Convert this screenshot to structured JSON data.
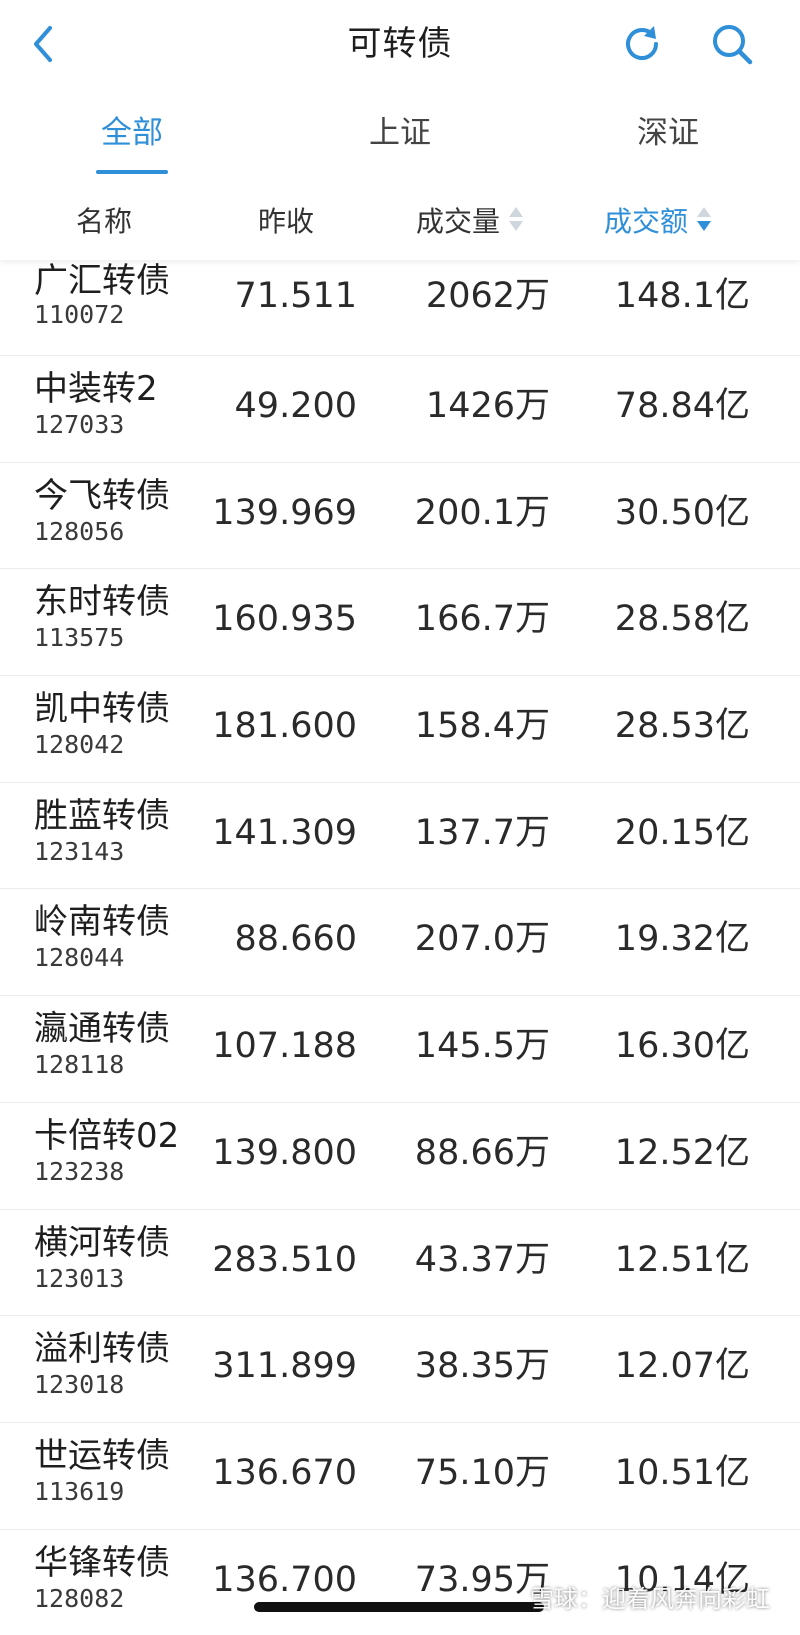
{
  "header": {
    "title": "可转债"
  },
  "icons": {
    "back": "chevron-left-icon",
    "refresh": "refresh-icon",
    "search": "search-icon"
  },
  "colors": {
    "accent": "#2f8fd8"
  },
  "tabs": [
    {
      "label": "全部",
      "active": true
    },
    {
      "label": "上证",
      "active": false
    },
    {
      "label": "深证",
      "active": false
    }
  ],
  "columns": {
    "name": "名称",
    "close": "昨收",
    "volume": "成交量",
    "amount": "成交额",
    "sorted_by": "amount",
    "sort_order": "desc"
  },
  "rows": [
    {
      "name": "广汇转债",
      "code": "110072",
      "close": "71.511",
      "volume": "2062万",
      "amount": "148.1亿"
    },
    {
      "name": "中装转2",
      "code": "127033",
      "close": "49.200",
      "volume": "1426万",
      "amount": "78.84亿"
    },
    {
      "name": "今飞转债",
      "code": "128056",
      "close": "139.969",
      "volume": "200.1万",
      "amount": "30.50亿"
    },
    {
      "name": "东时转债",
      "code": "113575",
      "close": "160.935",
      "volume": "166.7万",
      "amount": "28.58亿"
    },
    {
      "name": "凯中转债",
      "code": "128042",
      "close": "181.600",
      "volume": "158.4万",
      "amount": "28.53亿"
    },
    {
      "name": "胜蓝转债",
      "code": "123143",
      "close": "141.309",
      "volume": "137.7万",
      "amount": "20.15亿"
    },
    {
      "name": "岭南转债",
      "code": "128044",
      "close": "88.660",
      "volume": "207.0万",
      "amount": "19.32亿"
    },
    {
      "name": "瀛通转债",
      "code": "128118",
      "close": "107.188",
      "volume": "145.5万",
      "amount": "16.30亿"
    },
    {
      "name": "卡倍转02",
      "code": "123238",
      "close": "139.800",
      "volume": "88.66万",
      "amount": "12.52亿"
    },
    {
      "name": "横河转债",
      "code": "123013",
      "close": "283.510",
      "volume": "43.37万",
      "amount": "12.51亿"
    },
    {
      "name": "溢利转债",
      "code": "123018",
      "close": "311.899",
      "volume": "38.35万",
      "amount": "12.07亿"
    },
    {
      "name": "世运转债",
      "code": "113619",
      "close": "136.670",
      "volume": "75.10万",
      "amount": "10.51亿"
    },
    {
      "name": "华锋转债",
      "code": "128082",
      "close": "136.700",
      "volume": "73.95万",
      "amount": "10.14亿"
    }
  ],
  "watermark": "雪球：迎着风奔向彩虹"
}
